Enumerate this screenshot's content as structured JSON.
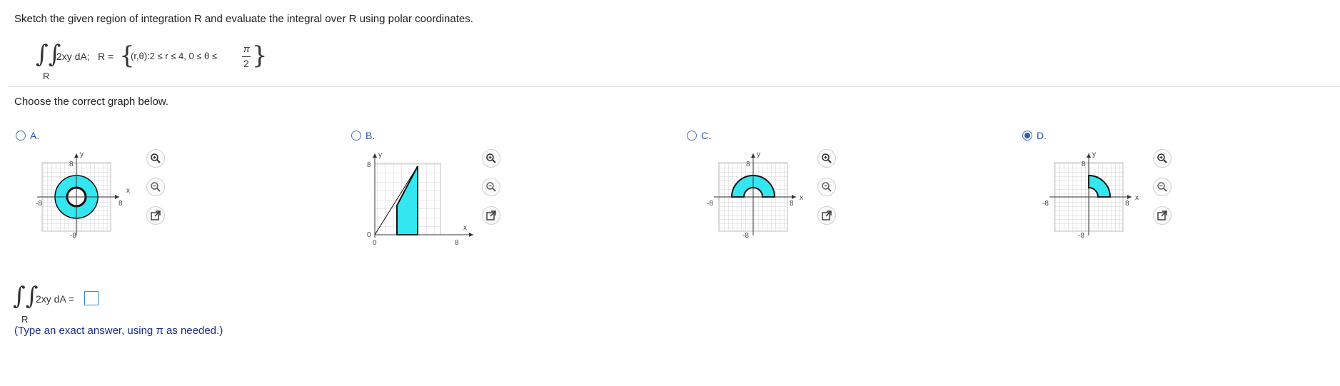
{
  "question": {
    "instruction": "Sketch the given region of integration R and evaluate the integral over R using polar coordinates.",
    "integrand": "2xy dA;",
    "region_lhs": "R =",
    "region_set": "(r,θ):2 ≤ r ≤ 4,  0 ≤ θ ≤",
    "pi": "π",
    "two": "2",
    "under_label": "R"
  },
  "choose_prompt": "Choose the correct graph below.",
  "options": [
    {
      "id": "A",
      "label": "A.",
      "selected": false
    },
    {
      "id": "B",
      "label": "B.",
      "selected": false
    },
    {
      "id": "C",
      "label": "C.",
      "selected": false
    },
    {
      "id": "D",
      "label": "D.",
      "selected": true
    }
  ],
  "graph_labels": {
    "y": "y",
    "x": "x",
    "eight": "8",
    "neg_eight": "-8",
    "zero": "0"
  },
  "tools": [
    "zoom-in-icon",
    "zoom-out-icon",
    "expand-icon"
  ],
  "answer": {
    "integrand": "2xy dA =",
    "under_label": "R",
    "value": "",
    "hint": "(Type an exact answer, using π as needed.)"
  },
  "colors": {
    "fill": "#33e6f0",
    "accent": "#2d55ad",
    "radio": "#2c5cb8"
  }
}
